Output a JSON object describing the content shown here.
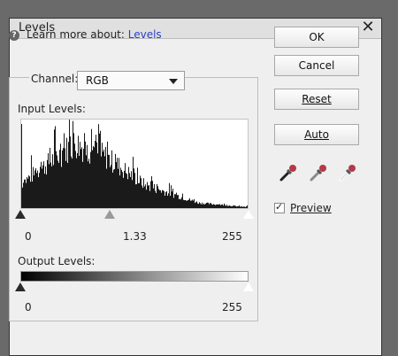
{
  "window": {
    "title": "Levels"
  },
  "help": {
    "prefix": "Learn more about:",
    "link": "Levels"
  },
  "channel": {
    "label": "Channel:",
    "value": "RGB"
  },
  "input_levels": {
    "label": "Input Levels:",
    "black": "0",
    "gray": "1.33",
    "white": "255"
  },
  "output_levels": {
    "label": "Output Levels:",
    "black": "0",
    "white": "255"
  },
  "buttons": {
    "ok": "OK",
    "cancel": "Cancel",
    "reset": "Reset",
    "auto": "Auto"
  },
  "preview": {
    "label": "Preview",
    "checked": true
  },
  "icons": {
    "help": "question-circle-icon",
    "close": "close-x-icon",
    "black_eyedropper": "black-point-eyedropper-icon",
    "gray_eyedropper": "gray-point-eyedropper-icon",
    "white_eyedropper": "white-point-eyedropper-icon"
  },
  "colors": {
    "link": "#2b3fc6",
    "eyedropper_tip": "#b23a48"
  }
}
